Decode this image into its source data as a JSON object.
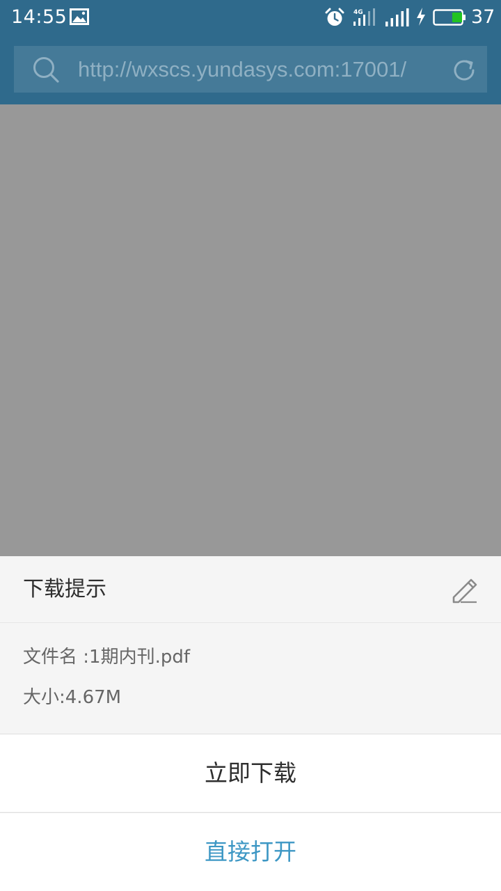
{
  "status_bar": {
    "time": "14:55",
    "network_type": "4G",
    "battery_level": "37",
    "battery_color": "#22c322"
  },
  "browser": {
    "url": "http://wxscs.yundasys.com:17001/",
    "header_color": "#2f6a8c"
  },
  "download_sheet": {
    "title": "下载提示",
    "file_name": "文件名 :1期内刊.pdf",
    "file_size": "大小:4.67M",
    "download_button": "立即下载",
    "open_button": "直接打开",
    "accent_color": "#3d97c4"
  },
  "icons": [
    "gallery-icon",
    "alarm-icon",
    "network-4g-icon",
    "signal-icon",
    "charging-icon",
    "battery-icon",
    "search-icon",
    "reload-icon",
    "edit-icon"
  ]
}
